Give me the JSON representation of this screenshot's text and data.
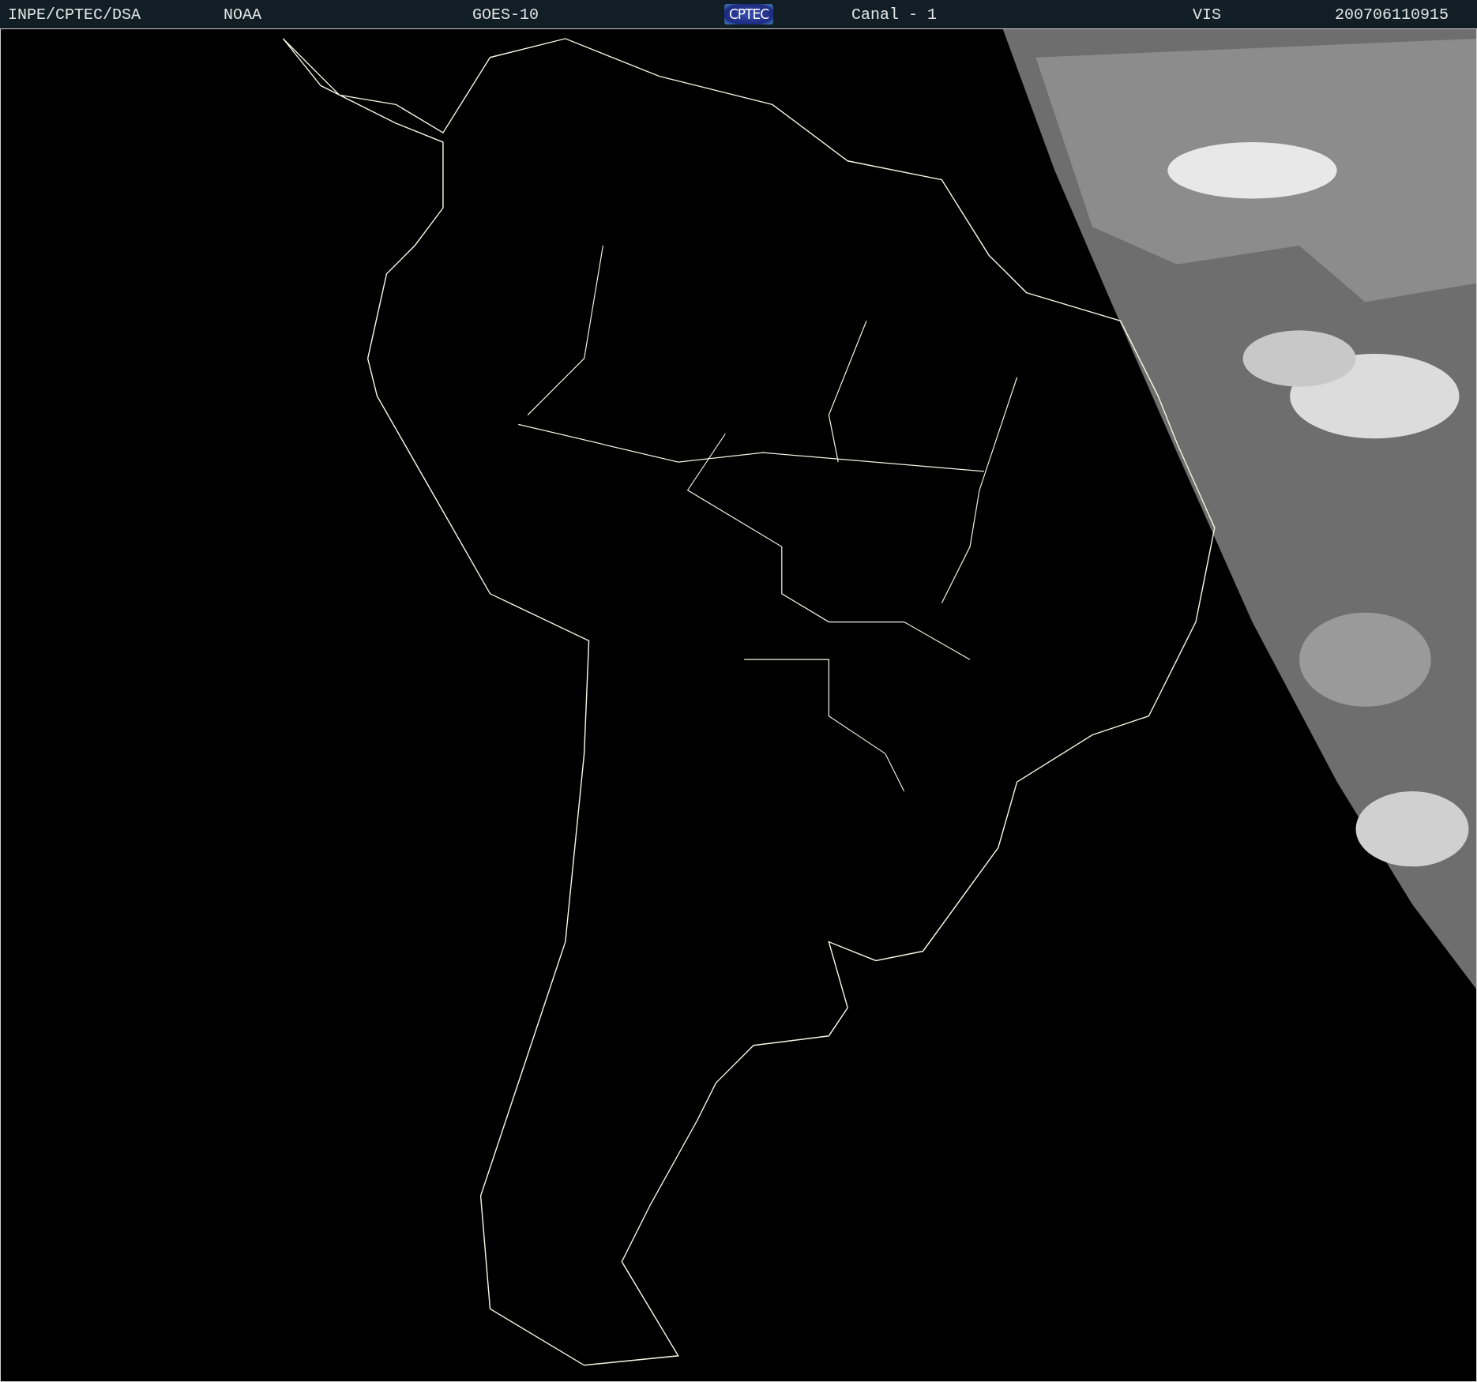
{
  "header": {
    "items": [
      {
        "kind": "text",
        "text": "INPE/CPTEC/DSA"
      },
      {
        "kind": "text",
        "text": "NOAA"
      },
      {
        "kind": "text",
        "text": "GOES-10"
      },
      {
        "kind": "logo",
        "text": "CPTEC"
      },
      {
        "kind": "text",
        "text": "Canal - 1"
      },
      {
        "kind": "text",
        "text": "VIS"
      },
      {
        "kind": "text",
        "text": "200706110915"
      }
    ]
  }
}
